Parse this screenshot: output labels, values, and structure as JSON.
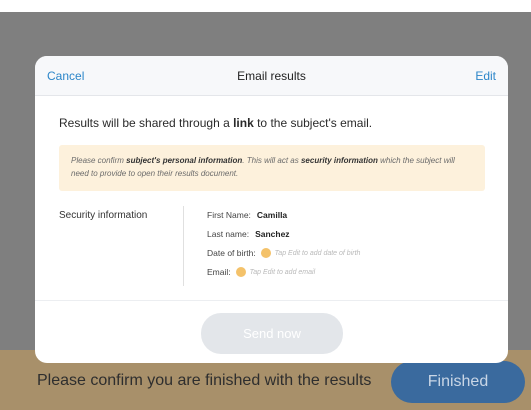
{
  "modal": {
    "cancel_label": "Cancel",
    "title": "Email results",
    "edit_label": "Edit",
    "intro_before": "Results will be shared through a ",
    "intro_bold": "link",
    "intro_after": " to the subject's email.",
    "notice": {
      "part1": "Please confirm ",
      "bold1": "subject's personal information",
      "part2": ". This will act as ",
      "bold2": "security information",
      "part3": " which the subject will need to provide to open their results document."
    },
    "security_label": "Security information",
    "fields": [
      {
        "label": "First Name:",
        "value": "Camilla"
      },
      {
        "label": "Last name:",
        "value": "Sanchez"
      },
      {
        "label": "Date of birth:",
        "hint": "Tap Edit to add date of birth"
      },
      {
        "label": "Email:",
        "hint": "Tap Edit to add email"
      }
    ],
    "send_label": "Send now"
  },
  "bottom_bar": {
    "prompt": "Please confirm you are finished with the results",
    "finished_label": "Finished"
  },
  "colors": {
    "accent": "#2c86c9",
    "overlay": "#7f7f7f",
    "notice_bg": "#fdf1dc",
    "warning_dot": "#f4c26a",
    "finished_button": "#3a6a9e"
  }
}
